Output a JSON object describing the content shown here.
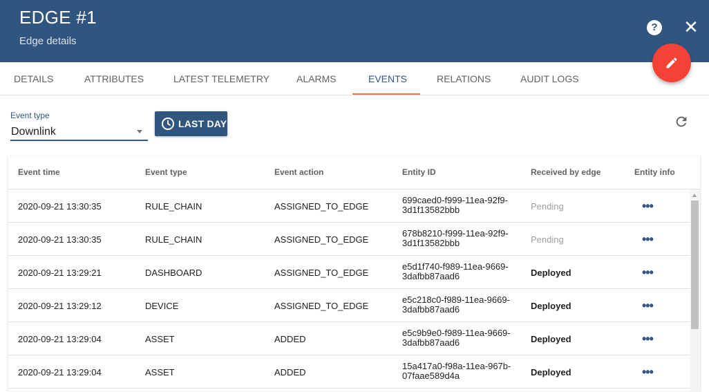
{
  "header": {
    "title": "EDGE #1",
    "subtitle": "Edge details",
    "help_icon": "help-circle-icon",
    "close_icon": "close-icon",
    "edit_icon": "pencil-icon",
    "background_color": "#305680",
    "fab_color": "#f44336"
  },
  "tabs": [
    {
      "label": "DETAILS"
    },
    {
      "label": "ATTRIBUTES"
    },
    {
      "label": "LATEST TELEMETRY"
    },
    {
      "label": "ALARMS"
    },
    {
      "label": "EVENTS",
      "active": true
    },
    {
      "label": "RELATIONS"
    },
    {
      "label": "AUDIT LOGS"
    }
  ],
  "filter": {
    "label": "Event type",
    "value": "Downlink",
    "time_button": "LAST DAY",
    "time_icon": "clock-icon",
    "refresh_icon": "refresh-icon"
  },
  "table": {
    "columns": [
      "Event time",
      "Event type",
      "Event action",
      "Entity ID",
      "Received by edge",
      "Entity info"
    ],
    "rows": [
      {
        "time": "2020-09-21 13:30:35",
        "type": "RULE_CHAIN",
        "action": "ASSIGNED_TO_EDGE",
        "id1": "699caed0-f999-11ea-92f9-",
        "id2": "3d1f13582bbb",
        "status": "Pending",
        "info": "•••"
      },
      {
        "time": "2020-09-21 13:30:35",
        "type": "RULE_CHAIN",
        "action": "ASSIGNED_TO_EDGE",
        "id1": "678b8210-f999-11ea-92f9-",
        "id2": "3d1f13582bbb",
        "status": "Pending",
        "info": "•••"
      },
      {
        "time": "2020-09-21 13:29:21",
        "type": "DASHBOARD",
        "action": "ASSIGNED_TO_EDGE",
        "id1": "e5d1f740-f989-11ea-9669-",
        "id2": "3dafbb87aad6",
        "status": "Deployed",
        "info": "•••"
      },
      {
        "time": "2020-09-21 13:29:12",
        "type": "DEVICE",
        "action": "ASSIGNED_TO_EDGE",
        "id1": "e5c218c0-f989-11ea-9669-",
        "id2": "3dafbb87aad6",
        "status": "Deployed",
        "info": "•••"
      },
      {
        "time": "2020-09-21 13:29:04",
        "type": "ASSET",
        "action": "ADDED",
        "id1": "e5c9b9e0-f989-11ea-9669-",
        "id2": "3dafbb87aad6",
        "status": "Deployed",
        "info": "•••"
      },
      {
        "time": "2020-09-21 13:29:04",
        "type": "ASSET",
        "action": "ADDED",
        "id1": "15a417a0-f98a-11ea-967b-",
        "id2": "07faae589d4a",
        "status": "Deployed",
        "info": "•••"
      }
    ]
  }
}
